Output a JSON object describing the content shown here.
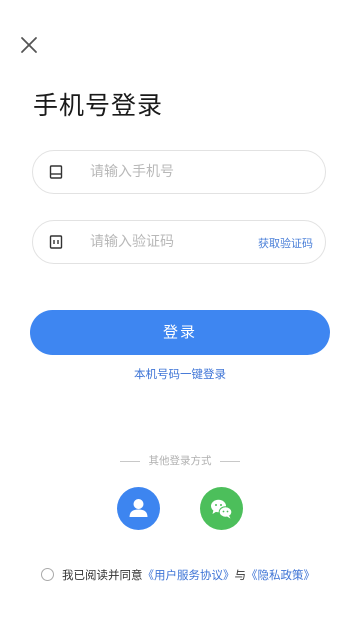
{
  "header": {
    "close_icon": "close-icon"
  },
  "page": {
    "title": "手机号登录"
  },
  "phone_field": {
    "icon": "phone-icon",
    "placeholder": "请输入手机号",
    "value": ""
  },
  "code_field": {
    "icon": "sim-card-icon",
    "placeholder": "请输入验证码",
    "value": "",
    "get_code_label": "获取验证码"
  },
  "login_button": {
    "label": "登录"
  },
  "one_key_login": {
    "label": "本机号码一键登录"
  },
  "other_login": {
    "title": "其他登录方式",
    "options": [
      {
        "icon": "user-icon",
        "color": "#3d85f0"
      },
      {
        "icon": "wechat-icon",
        "color": "#4cbf5b"
      }
    ]
  },
  "agreement": {
    "prefix": "我已阅读并同意",
    "user_agreement": "《用户服务协议》",
    "connector": "与",
    "privacy_policy": "《隐私政策》",
    "checked": false
  },
  "colors": {
    "primary": "#3e86f1",
    "link": "#3e74d6",
    "wechat": "#4cbf5b"
  }
}
